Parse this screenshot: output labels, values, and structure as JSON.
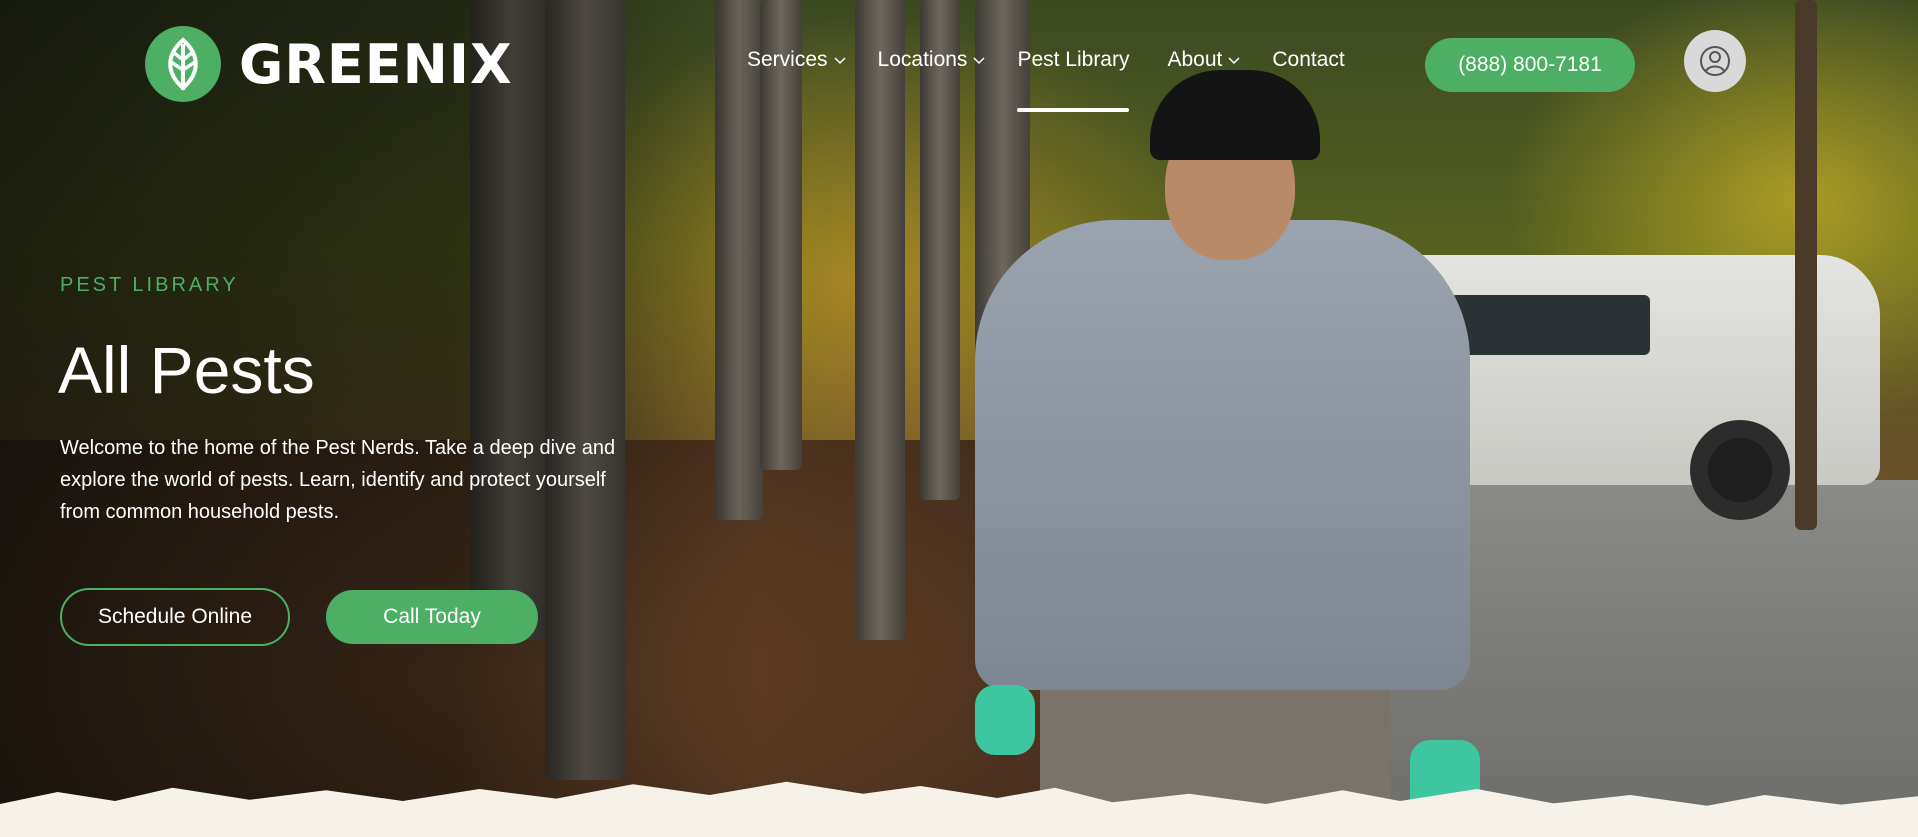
{
  "brand": {
    "name": "GREENIX",
    "logo_icon": "leaf-icon",
    "accent": "#4caf63"
  },
  "nav": {
    "items": [
      {
        "label": "Services",
        "has_dropdown": true
      },
      {
        "label": "Locations",
        "has_dropdown": true
      },
      {
        "label": "Pest Library",
        "has_dropdown": false,
        "active": true
      },
      {
        "label": "About",
        "has_dropdown": true
      },
      {
        "label": "Contact",
        "has_dropdown": false
      }
    ],
    "phone": "(888) 800-7181",
    "account_icon": "user-circle-icon"
  },
  "hero": {
    "eyebrow": "PEST LIBRARY",
    "title": "All Pests",
    "description": "Welcome to the home of the Pest Nerds. Take a deep dive and explore the world of pests. Learn, identify and protect yourself from common household pests.",
    "primary_cta": "Schedule Online",
    "secondary_cta": "Call Today"
  }
}
